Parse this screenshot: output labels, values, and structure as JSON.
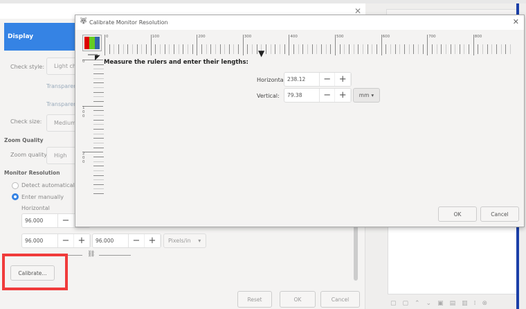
{
  "main": {
    "display_label": "Display",
    "check_style_label": "Check style:",
    "check_style_value": "Light che",
    "transparency1": "Transparenc",
    "transparency2": "Transparenc",
    "check_size_label": "Check size:",
    "check_size_value": "Medium",
    "zoom_quality_heading": "Zoom Quality",
    "zoom_quality_label": "Zoom quality:",
    "zoom_quality_value": "High",
    "monitor_heading": "Monitor Resolution",
    "detect_auto": "Detect automatically (",
    "enter_manually": "Enter manually",
    "horizontal_label": "Horizontal",
    "h_value_top": "96.000",
    "h_value": "96.000",
    "v_value": "96.000",
    "unit": "Pixels/in",
    "calibrate": "Calibrate...",
    "reset": "Reset",
    "ok": "OK",
    "cancel": "Cancel"
  },
  "dialog": {
    "title": "Calibrate Monitor Resolution",
    "instruction": "Measure the rulers and enter their lengths:",
    "horizontal_label": "Horizontal:",
    "horizontal_value": "238.12",
    "vertical_label": "Vertical:",
    "vertical_value": "79.38",
    "unit": "mm",
    "ok": "OK",
    "cancel": "Cancel",
    "h_ruler_labels": [
      "0",
      "100",
      "200",
      "300",
      "400",
      "500",
      "600",
      "700",
      "800"
    ],
    "v_ruler_labels": [
      "0",
      "100",
      "200"
    ]
  },
  "colors": {
    "accent": "#3583e4",
    "highlight": "#f03b3b"
  }
}
